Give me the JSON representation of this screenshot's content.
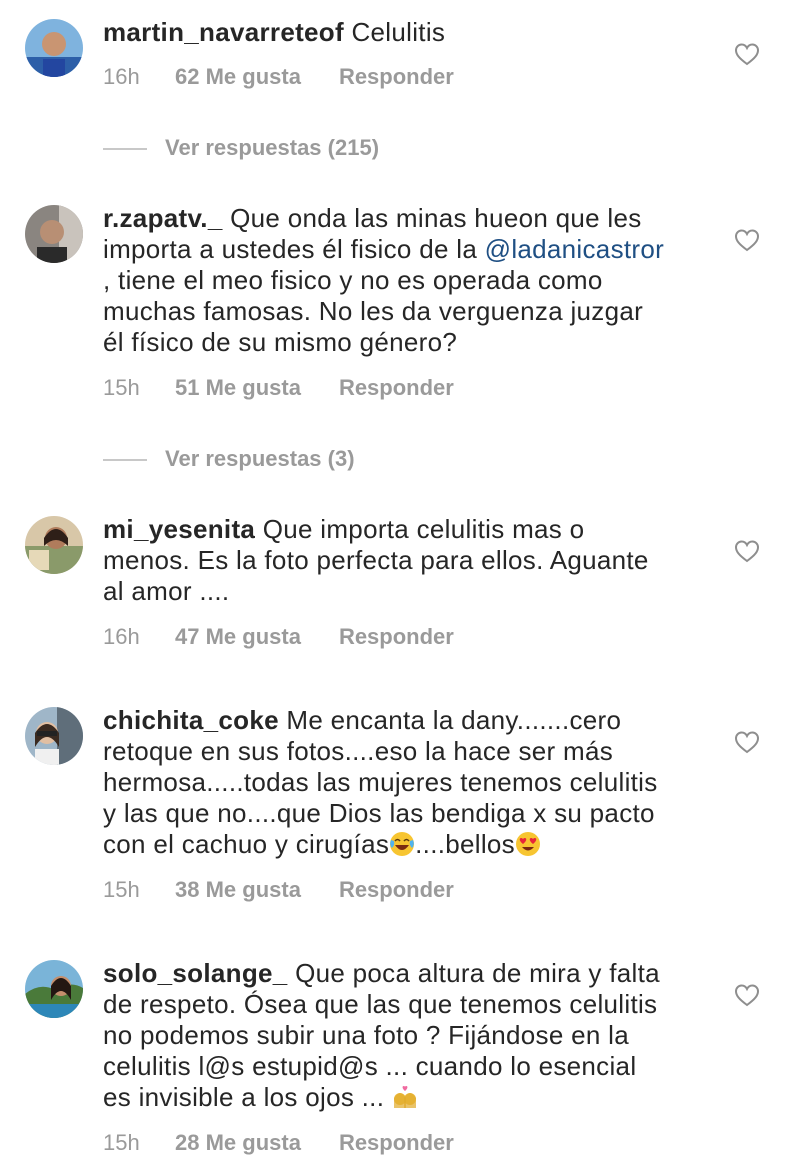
{
  "comments": [
    {
      "username": "martin_navarreteof",
      "text": "Celulitis",
      "time": "16h",
      "likes": "62 Me gusta",
      "reply": "Responder",
      "view_replies": "Ver respuestas (215)"
    },
    {
      "username": "r.zapatv._",
      "text_before": "Que onda las minas hueon que les\nimporta a ustedes él fisico de la ",
      "mention": "@ladanicastror",
      "text_after": "\n, tiene el meo fisico y no es operada como\nmuchas famosas. No les da verguenza juzgar\nél físico de su mismo género?",
      "time": "15h",
      "likes": "51 Me gusta",
      "reply": "Responder",
      "view_replies": "Ver respuestas (3)"
    },
    {
      "username": "mi_yesenita",
      "text": "Que importa celulitis mas o\nmenos. Es la foto perfecta para ellos. Aguante\nal amor ....",
      "time": "16h",
      "likes": "47 Me gusta",
      "reply": "Responder"
    },
    {
      "username": "chichita_coke",
      "text": "Me encanta la dany.......cero\nretoque en sus fotos....eso la hace ser más\nhermosa.....todas las mujeres tenemos celulitis\ny las que no....que Dios las bendiga x su pacto\ncon  el cachuo y cirugías",
      "emoji1": "face-with-tears-of-joy",
      "text_mid": "....bellos",
      "emoji2": "heart-eyes-face",
      "time": "15h",
      "likes": "38 Me gusta",
      "reply": "Responder"
    },
    {
      "username": "solo_solange_",
      "text": "Que poca altura de mira y falta\nde respeto.  Ósea que las que tenemos celulitis\nno podemos subir una foto ?  Fijándose en la\ncelulitis l@s estupid@s ... cuando lo esencial\nes invisible a los ojos ... ",
      "emoji1": "kiss-woman-woman",
      "time": "15h",
      "likes": "28 Me gusta",
      "reply": "Responder"
    }
  ],
  "colors": {
    "text": "#262626",
    "meta": "#9a9a9a",
    "mention": "#1f4f83"
  },
  "icons": {
    "like": "heart-outline-icon"
  }
}
